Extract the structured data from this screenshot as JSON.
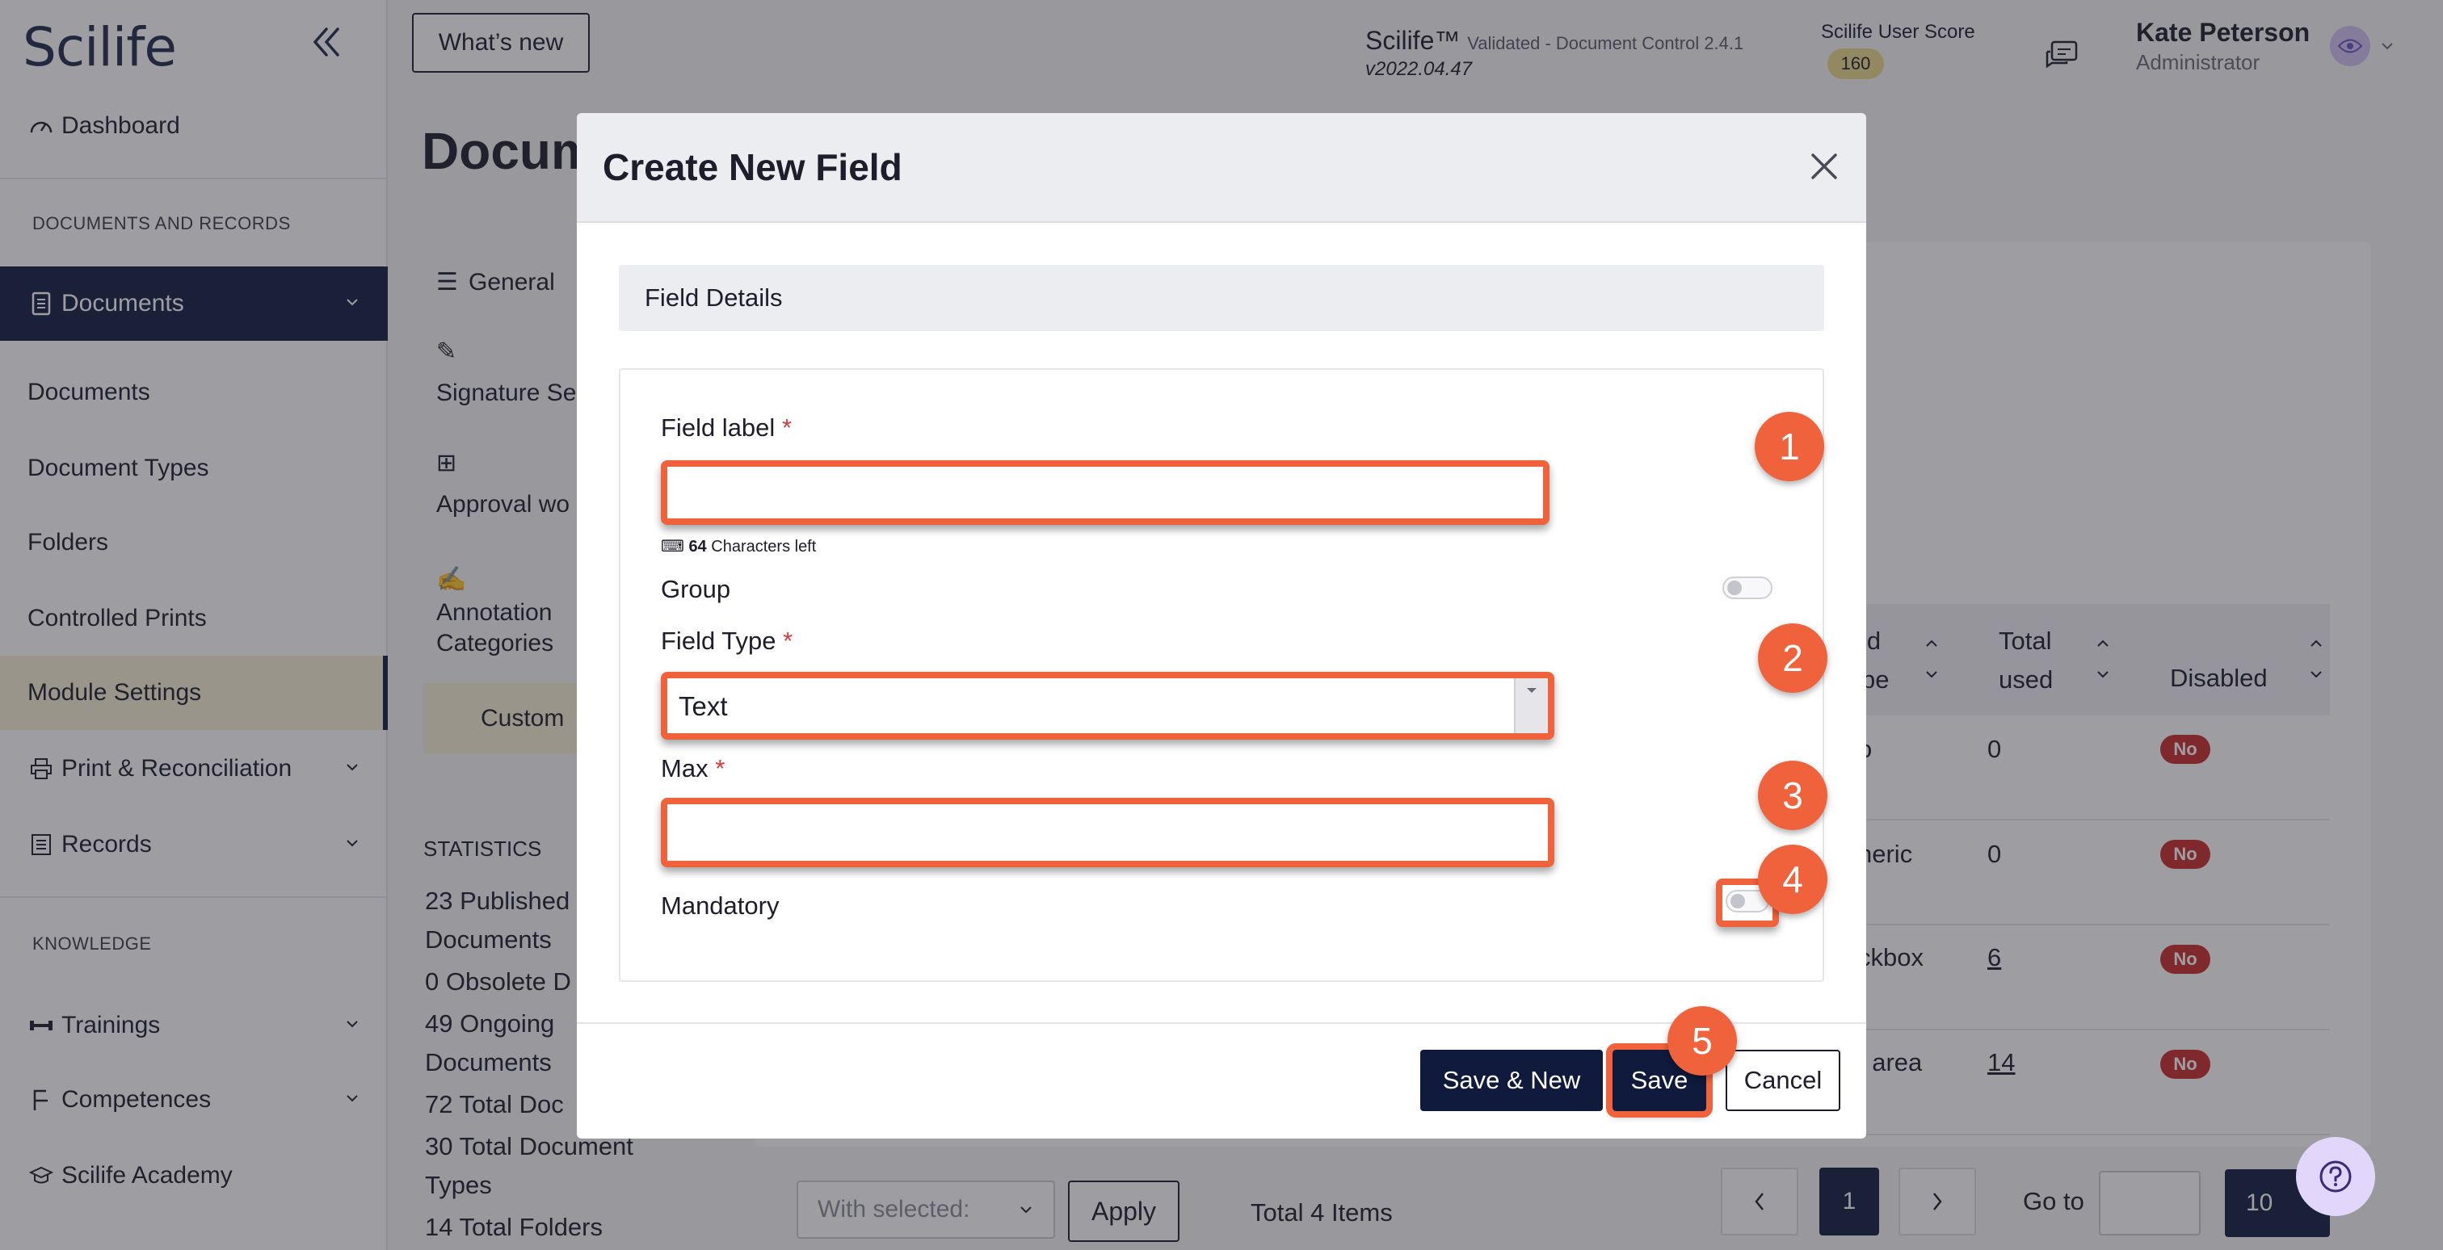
{
  "app": {
    "logo": "Scilife",
    "whats_new": "What’s new",
    "product_name": "Scilife™",
    "product_desc": "Validated - Document Control 2.4.1",
    "version": "v2022.04.47",
    "score_label": "Scilife User Score",
    "score_value": "160",
    "user_name": "Kate Peterson",
    "user_role": "Administrator"
  },
  "sidebar": {
    "dashboard": "Dashboard",
    "section_docs": "DOCUMENTS AND RECORDS",
    "documents_group": "Documents",
    "items": [
      "Documents",
      "Document Types",
      "Folders",
      "Controlled Prints",
      "Module Settings"
    ],
    "print_reconciliation": "Print & Reconciliation",
    "records": "Records",
    "section_knowledge": "KNOWLEDGE",
    "trainings": "Trainings",
    "competences": "Competences",
    "academy": "Scilife Academy"
  },
  "main": {
    "page_title": "Docum",
    "nav": {
      "general": "General",
      "signature": "Signature Se",
      "approval": "Approval wo",
      "annotation_1": "Annotation",
      "annotation_2": "Categories",
      "custom": "Custom"
    },
    "statistics": {
      "title": "STATISTICS",
      "lines": [
        "23  Published",
        "Documents",
        "0  Obsolete D",
        "49  Ongoing",
        "Documents",
        "72  Total Doc",
        "30  Total Document",
        "Types",
        "14  Total Folders"
      ]
    },
    "table": {
      "headers": {
        "field_type_1": "ld",
        "field_type_2": "pe",
        "total_used_1": "Total",
        "total_used_2": "used",
        "disabled": "Disabled"
      },
      "rows": [
        {
          "type": "o",
          "used": "0",
          "disabled": "No"
        },
        {
          "type": "neric",
          "used": "0",
          "disabled": "No"
        },
        {
          "type": "ckbox",
          "used": "6",
          "disabled": "No"
        },
        {
          "type": "t area",
          "used": "14",
          "disabled": "No"
        }
      ]
    },
    "footer": {
      "with_selected": "With selected:",
      "apply": "Apply",
      "total_items": "Total 4 Items",
      "page_current": "1",
      "goto_label": "Go to",
      "per_page": "10"
    }
  },
  "modal": {
    "title": "Create New Field",
    "section": "Field Details",
    "field_label": "Field label",
    "required_mark": "*",
    "chars_count": "64",
    "chars_text": "Characters left",
    "group_label": "Group",
    "field_type_label": "Field Type",
    "field_type_value": "Text",
    "max_label": "Max",
    "mandatory_label": "Mandatory",
    "save_new": "Save & New",
    "save": "Save",
    "cancel": "Cancel"
  },
  "callouts": [
    "1",
    "2",
    "3",
    "4",
    "5"
  ],
  "colors": {
    "navy": "#0f1a3c",
    "callout_orange": "#f0623c",
    "badge_red": "#c82a2a",
    "score_gold": "#e9d98a"
  },
  "icons": [
    "dashboard-icon",
    "document-icon",
    "print-icon",
    "records-icon",
    "trainings-icon",
    "competences-icon",
    "academy-icon",
    "chat-icon",
    "close-icon",
    "help-icon",
    "chevron-left-double-icon"
  ]
}
